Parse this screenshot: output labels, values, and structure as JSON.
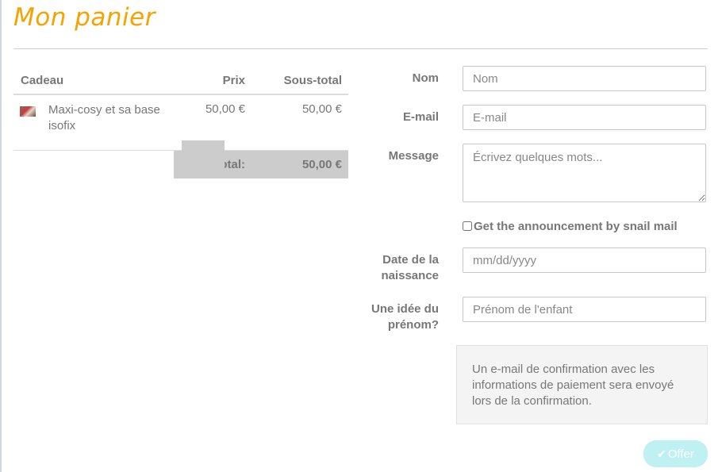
{
  "page": {
    "title": "Mon panier"
  },
  "cart": {
    "columns": {
      "gift": "Cadeau",
      "price": "Prix",
      "subtotal": "Sous-total"
    },
    "items": [
      {
        "name": "Maxi-cosy et sa base isofix",
        "price": "50,00 €",
        "subtotal": "50,00 €",
        "thumb_icon": "product-thumbnail"
      }
    ],
    "total_label": "Total:",
    "total_value": "50,00 €"
  },
  "form": {
    "name": {
      "label": "Nom",
      "placeholder": "Nom"
    },
    "email": {
      "label": "E-mail",
      "placeholder": "E-mail"
    },
    "message": {
      "label": "Message",
      "placeholder": "Écrivez quelques mots..."
    },
    "snail_mail": {
      "label": "Get the announcement by snail mail",
      "checked": false
    },
    "birth_date": {
      "label_line1": "Date de la",
      "label_line2": "naissance",
      "placeholder": "mm/dd/yyyy"
    },
    "first_name_idea": {
      "label_line1": "Une idée du",
      "label_line2": "prénom?",
      "placeholder": "Prénom de l'enfant"
    },
    "info": "Un e-mail de confirmation avec les informations de paiement sera envoyé lors de la confirmation.",
    "submit": {
      "label": "Offer",
      "icon": "check-icon"
    }
  },
  "colors": {
    "title": "#f5a300",
    "button": "#bff0f2",
    "total_bg": "#cccccc"
  }
}
